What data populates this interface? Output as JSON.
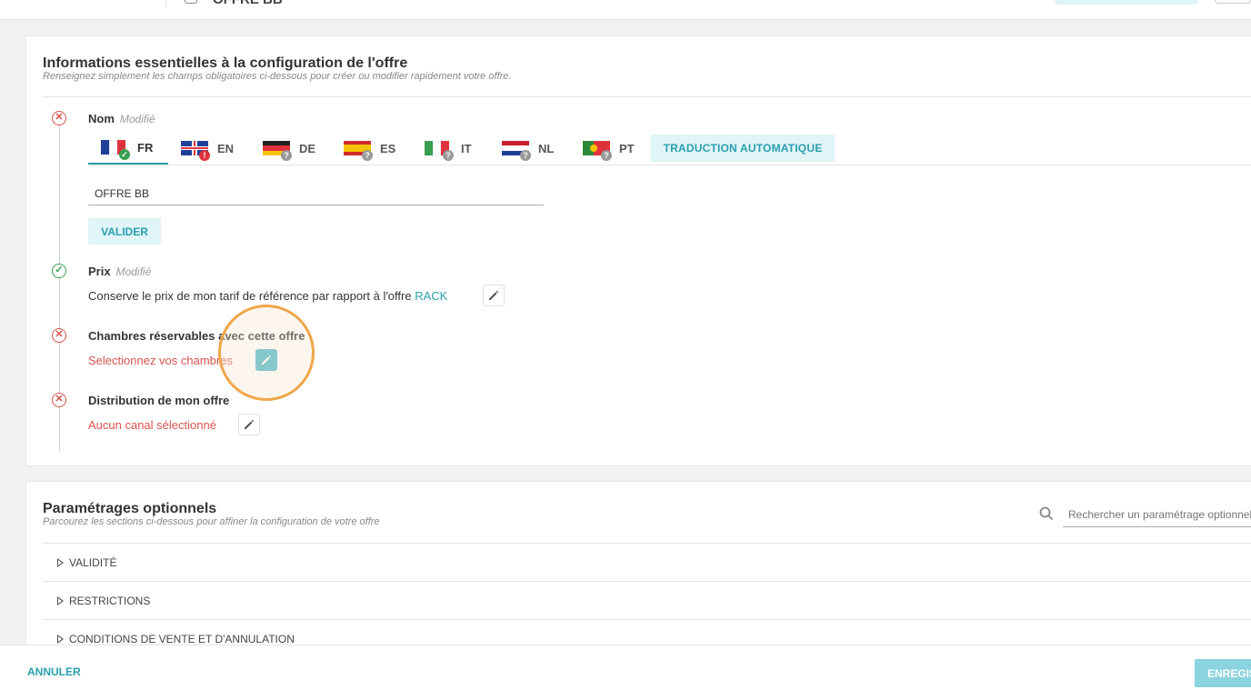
{
  "header": {
    "title": "OFFRE BB"
  },
  "essentials": {
    "title": "Informations essentielles à la configuration de l'offre",
    "subtitle": "Renseignez simplement les champs obligatoires ci-dessous pour créer ou modifier rapidement votre offre.",
    "name_step": {
      "title": "Nom",
      "modified": "Modifié",
      "value": "OFFRE BB",
      "validate_label": "VALIDER"
    },
    "languages": [
      {
        "code": "FR",
        "status": "ok"
      },
      {
        "code": "EN",
        "status": "error"
      },
      {
        "code": "DE",
        "status": "unknown"
      },
      {
        "code": "ES",
        "status": "unknown"
      },
      {
        "code": "IT",
        "status": "unknown"
      },
      {
        "code": "NL",
        "status": "unknown"
      },
      {
        "code": "PT",
        "status": "unknown"
      }
    ],
    "auto_translate_label": "TRADUCTION AUTOMATIQUE",
    "price_step": {
      "title": "Prix",
      "modified": "Modifié",
      "text": "Conserve le prix de mon tarif de référence par rapport à l'offre",
      "link": "RACK"
    },
    "rooms_step": {
      "title": "Chambres réservables avec cette offre",
      "text": "Selectionnez vos chambres"
    },
    "distribution_step": {
      "title": "Distribution de mon offre",
      "text": "Aucun canal sélectionné"
    }
  },
  "optional": {
    "title": "Paramétrages optionnels",
    "subtitle": "Parcourez les sections ci-dessous pour affiner la configuration de votre offre",
    "search_placeholder": "Rechercher un paramétrage optionnel",
    "sections": [
      "VALIDITÉ",
      "RESTRICTIONS",
      "CONDITIONS DE VENTE ET D'ANNULATION"
    ]
  },
  "footer": {
    "cancel_label": "ANNULER",
    "save_label": "ENREGISTRER"
  },
  "colors": {
    "accent": "#2a9fae",
    "error": "#d9534f",
    "success": "#3a9e4f",
    "highlight": "#f0a64a"
  }
}
